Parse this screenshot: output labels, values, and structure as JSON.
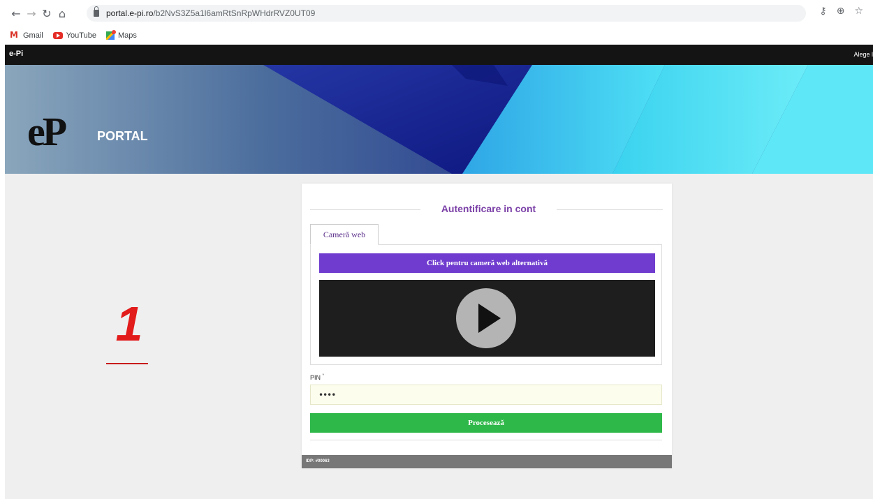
{
  "browser": {
    "url_host": "portal.e-pi.ro",
    "url_path": "/b2NvS3Z5a1l6amRtSnRpWHdrRVZ0UT09",
    "bookmarks": [
      {
        "label": "Gmail",
        "icon": "gmail-icon"
      },
      {
        "label": "YouTube",
        "icon": "youtube-icon"
      },
      {
        "label": "Maps",
        "icon": "maps-icon"
      }
    ]
  },
  "topbar": {
    "brand": "e-Pi",
    "language": "Alege l"
  },
  "banner": {
    "logo_text": "eP",
    "title": "PORTAL"
  },
  "annotation": {
    "step_number": "1",
    "color": "#e21b1b"
  },
  "login": {
    "legend": "Autentificare in cont",
    "tab_label": "Cameră web",
    "alt_camera_button": "Click pentru cameră web alternativă",
    "pin_label": "PIN",
    "pin_required_mark": "*",
    "pin_value": "••••",
    "process_button": "Procesează",
    "footer_text": "IDP: #00063",
    "colors": {
      "legend": "#7a3fa6",
      "alt_camera": "#6f3ccf",
      "process": "#2fb84a"
    }
  }
}
